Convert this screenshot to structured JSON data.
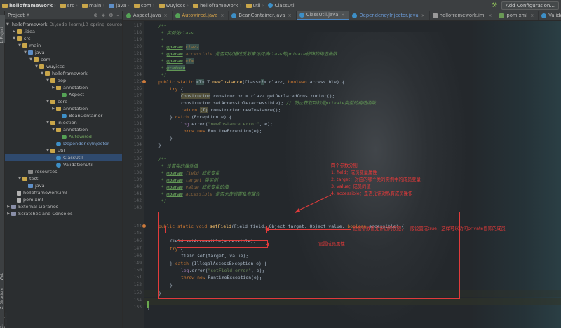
{
  "navbar": {
    "breadcrumbs": [
      "helloframework",
      "src",
      "main",
      "java",
      "com",
      "wuyiccc",
      "helloframework",
      "util",
      "ClassUtil"
    ],
    "add_configuration": "Add Configuration..."
  },
  "tool_strip": {
    "project_label": "1: Project",
    "web_label": "Web",
    "structure_label": "Z: Structure",
    "favorites_label": "2: Favorites"
  },
  "project_panel": {
    "header": "Project",
    "tree": [
      {
        "label": "helloframework",
        "sub": "D:\\code_learn\\10_spring_source_c",
        "level": 0,
        "expanded": true,
        "icon": "folder-icon"
      },
      {
        "label": ".idea",
        "level": 1,
        "expanded": false,
        "icon": "folder-icon"
      },
      {
        "label": "src",
        "level": 1,
        "expanded": true,
        "icon": "folder-icon"
      },
      {
        "label": "main",
        "level": 2,
        "expanded": true,
        "icon": "folder-icon"
      },
      {
        "label": "java",
        "level": 3,
        "expanded": true,
        "icon": "source-folder-icon"
      },
      {
        "label": "com",
        "level": 4,
        "expanded": true,
        "icon": "package-icon"
      },
      {
        "label": "wuyiccc",
        "level": 5,
        "expanded": true,
        "icon": "package-icon"
      },
      {
        "label": "helloframework",
        "level": 6,
        "expanded": true,
        "icon": "package-icon"
      },
      {
        "label": "aop",
        "level": 7,
        "expanded": true,
        "icon": "package-icon"
      },
      {
        "label": "annotation",
        "level": 8,
        "expanded": false,
        "icon": "package-icon"
      },
      {
        "label": "Aspect",
        "level": 9,
        "expanded": null,
        "icon": "annotation-icon"
      },
      {
        "label": "core",
        "level": 7,
        "expanded": true,
        "icon": "package-icon"
      },
      {
        "label": "annotation",
        "level": 8,
        "expanded": false,
        "icon": "package-icon"
      },
      {
        "label": "BeanContainer",
        "level": 9,
        "expanded": null,
        "icon": "class-icon"
      },
      {
        "label": "injection",
        "level": 7,
        "expanded": true,
        "icon": "package-icon"
      },
      {
        "label": "annotation",
        "level": 8,
        "expanded": true,
        "icon": "package-icon"
      },
      {
        "label": "Autowired",
        "level": 9,
        "expanded": null,
        "icon": "annotation-icon",
        "style": "green"
      },
      {
        "label": "DependencyInjector",
        "level": 8,
        "expanded": null,
        "icon": "class-icon",
        "style": "blue"
      },
      {
        "label": "util",
        "level": 7,
        "expanded": true,
        "icon": "package-icon"
      },
      {
        "label": "ClassUtil",
        "level": 8,
        "expanded": null,
        "icon": "class-icon",
        "selected": true
      },
      {
        "label": "ValidationUtil",
        "level": 8,
        "expanded": null,
        "icon": "class-icon"
      },
      {
        "label": "resources",
        "level": 3,
        "expanded": null,
        "icon": "resources-folder-icon"
      },
      {
        "label": "test",
        "level": 2,
        "expanded": true,
        "icon": "folder-icon"
      },
      {
        "label": "java",
        "level": 3,
        "expanded": null,
        "icon": "test-folder-icon"
      },
      {
        "label": "helloframework.iml",
        "level": 1,
        "expanded": null,
        "icon": "iml-file-icon"
      },
      {
        "label": "pom.xml",
        "level": 1,
        "expanded": null,
        "icon": "maven-file-icon"
      },
      {
        "label": "External Libraries",
        "level": 0,
        "expanded": false,
        "icon": "libraries-icon"
      },
      {
        "label": "Scratches and Consoles",
        "level": 0,
        "expanded": false,
        "icon": "scratches-icon"
      }
    ]
  },
  "tabs": [
    {
      "label": "Aspect.java",
      "icon": "annotation-icon",
      "style": "normal"
    },
    {
      "label": "Autowired.java",
      "icon": "annotation-icon",
      "style": "warn"
    },
    {
      "label": "BeanContainer.java",
      "icon": "class-icon",
      "style": "normal"
    },
    {
      "label": "ClassUtil.java",
      "icon": "class-icon",
      "style": "normal",
      "active": true
    },
    {
      "label": "DependencyInjector.java",
      "icon": "class-icon",
      "style": "blue"
    },
    {
      "label": "helloframework.iml",
      "icon": "iml-file-icon",
      "style": "normal"
    },
    {
      "label": "pom.xml",
      "icon": "maven-file-icon",
      "style": "normal"
    },
    {
      "label": "ValidationUtil.java",
      "icon": "class-icon",
      "style": "normal"
    }
  ],
  "editor": {
    "line_numbers": [
      "117",
      "118",
      "119",
      "120",
      "121",
      "122",
      "123",
      "124",
      "125",
      "126",
      "127",
      "128",
      "129",
      "130",
      "131",
      "132",
      "133",
      "134",
      "135",
      "136",
      "137",
      "138",
      "139",
      "140",
      "141",
      "142",
      "143",
      "144",
      "145",
      "146",
      "147",
      "148",
      "149",
      "150",
      "151",
      "152",
      "153",
      "154",
      "155"
    ],
    "code": {
      "l117": "/**",
      "l118": " * 实例化class",
      "l119": " *",
      "l120_tag": "@param",
      "l120_p": "clazz",
      "l121_tag": "@param",
      "l121_p": "accessible",
      "l121_text": "是否可以通过反射来访问该class的private修饰的构造函数",
      "l122_tag": "@param",
      "l122_p": "<T>",
      "l123_tag": "@return",
      "l124": " */",
      "l125_a": "public static ",
      "l125_b": "<T>",
      "l125_c": " T ",
      "l125_fn": "newInstance",
      "l125_d": "(Class<",
      "l125_e": "?",
      "l125_f": "> clazz, ",
      "l125_g": "boolean",
      "l125_h": " accessible) {",
      "l126_kw": "try",
      "l126_p": " {",
      "l127_hl": "Constructor",
      "l127_p": " constructor = clazz.getDeclaredConstructor();",
      "l128_p": "constructor.setAccessible(accessible);",
      "l128_cm": "// 防止获取到的是private类型的构造函数",
      "l129_kw": "return",
      "l129_hl": "(T)",
      "l129_p": " constructor.newInstance();",
      "l130_a": "} ",
      "l130_kw": "catch",
      "l130_b": " (Exception e) {",
      "l131_fld": "log",
      "l131_p": ".error(",
      "l131_st": "\"newInstance error\"",
      "l131_q": ", e);",
      "l132_kw": "throw new",
      "l132_p": " RuntimeException(e);",
      "l133": "}",
      "l134": "}",
      "l136": "/**",
      "l137": " * 设置类的属性值",
      "l138_tag": "@param",
      "l138_p": "field",
      "l138_t": "成员变量",
      "l139_tag": "@param",
      "l139_p": "target",
      "l139_t": "类实例",
      "l140_tag": "@param",
      "l140_p": "value",
      "l140_t": "成员变量的值",
      "l141_tag": "@param",
      "l141_p": "accessible",
      "l141_t": "是否允许设置私有属性",
      "l142": " */",
      "l143_a": "public static void ",
      "l143_fn": "setField",
      "l143_b": "(Field field, Object target, Object value, ",
      "l143_kw": "boolean",
      "l143_c": " accessible) {",
      "l145": "field.setAccessible(accessible);",
      "l146_kw": "try",
      "l146_p": " {",
      "l147": "field.set(target, value);",
      "l148_a": "} ",
      "l148_kw": "catch",
      "l148_b": " (IllegalAccessException e) {",
      "l149_fld": "log",
      "l149_p": ".error(",
      "l149_st": "\"setField error\"",
      "l149_q": ", e);",
      "l150_kw": "throw new",
      "l150_p": " RuntimeException(e);",
      "l151": "}",
      "l152": "}",
      "l153": "}"
    },
    "annotations": {
      "params_note": [
        "四个参数分别",
        "1. field：成员变量属性",
        "2. target：对应的哪个类的实例中的成员变量",
        "3. value：成员的值",
        "4. accessible：是否允许对私有成员操作"
      ],
      "accessible_note": "根据参数值允许访问权限，一般设置成true，这样可以访问private修饰的成员",
      "set_note": "设置成员属性"
    }
  },
  "colors": {
    "annotation_red": "#e13b3b",
    "keyword": "#cc7832",
    "comment": "#629755",
    "function": "#ffc66d",
    "string": "#6a8759",
    "selection": "#2f4a6e"
  }
}
